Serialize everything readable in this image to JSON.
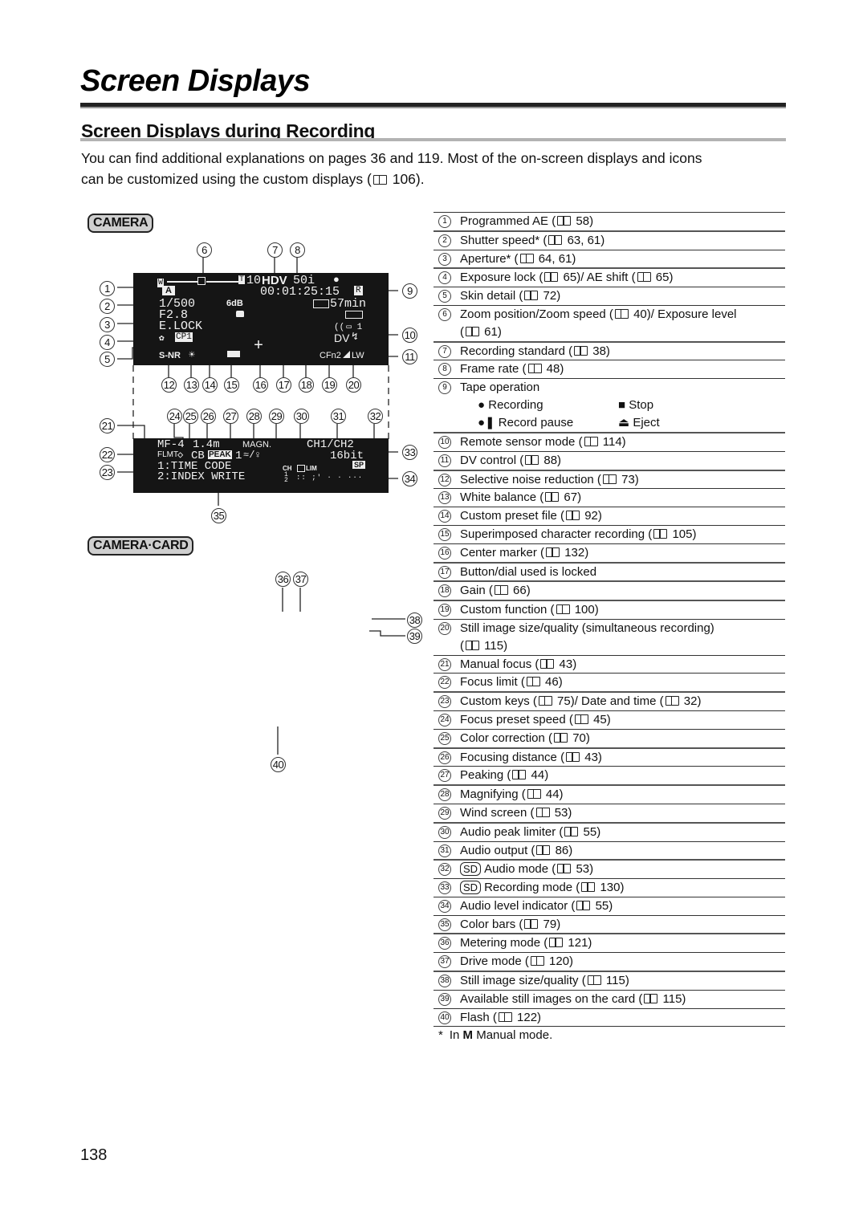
{
  "page": {
    "title": "Screen Displays",
    "section_title": "Screen Displays during Recording",
    "intro_line1": "You can find additional explanations on pages 36 and 119. Most of the on-screen displays and icons",
    "intro_line2_a": "can be customized using the custom displays (",
    "intro_line2_b": " 106).",
    "page_number": "138"
  },
  "diagrams": {
    "camera_badge": "CAMERA",
    "camera_card_badge": "CAMERA·CARD",
    "lcd_top": {
      "zoom_w": "W",
      "zoom_t": "T",
      "zoom_speed": "10",
      "recording_standard": "HDV",
      "frame_rate": "50i",
      "tape_op": "●",
      "program_ae": "A",
      "timecode": "00:01:25:15",
      "timecode_flag": "R",
      "shutter": "1/500",
      "gain": "6dB",
      "remaining": "57min",
      "aperture": "F2.8",
      "lock": "E.LOCK",
      "remote": "(( ▭ 1",
      "cp": "CP1",
      "dv": "DV",
      "snr": "S-NR",
      "wb": "☀",
      "center": "+",
      "cfn": "CFn2",
      "still": "LW"
    },
    "lcd_bottom": {
      "mf": "MF-4",
      "distance": "1.4m",
      "magn": "MAGN.",
      "channels": "CH1/CH2",
      "flmt": "FLMT",
      "cb": "CB",
      "peak": "PEAK",
      "peak_num": "1",
      "wind": "≈/♀",
      "bits": "16bit",
      "line1": "1:TIME CODE",
      "line2": "2:INDEX WRITE",
      "ch_label": "CH",
      "lim": "LIM",
      "sp": "SP",
      "ch_nums": "1\n2",
      "level": ":: ;' · · ···"
    },
    "callouts_top": [
      "1",
      "2",
      "3",
      "4",
      "5",
      "6",
      "7",
      "8",
      "9",
      "10",
      "11",
      "12",
      "13",
      "14",
      "15",
      "16",
      "17",
      "18",
      "19",
      "20"
    ],
    "callouts_bottom": [
      "21",
      "22",
      "23",
      "24",
      "25",
      "26",
      "27",
      "28",
      "29",
      "30",
      "31",
      "32",
      "33",
      "34",
      "35"
    ],
    "callouts_card": [
      "36",
      "37",
      "38",
      "39",
      "40"
    ]
  },
  "legend": [
    {
      "n": "1",
      "text": "Programmed AE (",
      "ref": " 58)"
    },
    {
      "n": "2",
      "text": "Shutter speed* (",
      "ref": " 63, 61)"
    },
    {
      "n": "3",
      "text": "Aperture* (",
      "ref": " 64, 61)"
    },
    {
      "n": "4",
      "text": "Exposure lock (",
      "ref": " 65)/ AE shift (",
      "ref2": " 65)"
    },
    {
      "n": "5",
      "text": "Skin detail (",
      "ref": " 72)"
    },
    {
      "n": "6",
      "text": "Zoom position/Zoom speed (",
      "ref": " 40)/ Exposure level",
      "cont": " 61)"
    },
    {
      "n": "7",
      "text": "Recording standard (",
      "ref": " 38)"
    },
    {
      "n": "8",
      "text": "Frame rate (",
      "ref": " 48)"
    },
    {
      "n": "9",
      "text": "Tape operation"
    },
    {
      "n": "10",
      "text": "Remote sensor mode (",
      "ref": " 114)"
    },
    {
      "n": "11",
      "text": "DV control (",
      "ref": " 88)"
    },
    {
      "n": "12",
      "text": "Selective noise reduction (",
      "ref": " 73)"
    },
    {
      "n": "13",
      "text": "White balance (",
      "ref": " 67)"
    },
    {
      "n": "14",
      "text": "Custom preset file (",
      "ref": " 92)"
    },
    {
      "n": "15",
      "text": "Superimposed character recording (",
      "ref": " 105)"
    },
    {
      "n": "16",
      "text": "Center marker (",
      "ref": " 132)"
    },
    {
      "n": "17",
      "text": "Button/dial used is locked"
    },
    {
      "n": "18",
      "text": "Gain (",
      "ref": " 66)"
    },
    {
      "n": "19",
      "text": "Custom function (",
      "ref": " 100)"
    },
    {
      "n": "20",
      "text": "Still image size/quality (simultaneous recording)",
      "cont": " 115)"
    },
    {
      "n": "21",
      "text": "Manual focus (",
      "ref": " 43)"
    },
    {
      "n": "22",
      "text": "Focus limit (",
      "ref": " 46)"
    },
    {
      "n": "23",
      "text": "Custom keys (",
      "ref": " 75)/ Date and time (",
      "ref2": " 32)"
    },
    {
      "n": "24",
      "text": "Focus preset speed (",
      "ref": " 45)"
    },
    {
      "n": "25",
      "text": "Color correction (",
      "ref": " 70)"
    },
    {
      "n": "26",
      "text": "Focusing distance (",
      "ref": " 43)"
    },
    {
      "n": "27",
      "text": "Peaking (",
      "ref": " 44)"
    },
    {
      "n": "28",
      "text": "Magnifying (",
      "ref": " 44)"
    },
    {
      "n": "29",
      "text": "Wind screen (",
      "ref": " 53)"
    },
    {
      "n": "30",
      "text": "Audio peak limiter (",
      "ref": " 55)"
    },
    {
      "n": "31",
      "text": "Audio output (",
      "ref": " 86)"
    },
    {
      "n": "32",
      "sd": "SD",
      "text": "Audio mode (",
      "ref": " 53)"
    },
    {
      "n": "33",
      "sd": "SD",
      "text": "Recording mode (",
      "ref": " 130)"
    },
    {
      "n": "34",
      "text": "Audio level indicator (",
      "ref": " 55)"
    },
    {
      "n": "35",
      "text": "Color bars (",
      "ref": " 79)"
    },
    {
      "n": "36",
      "text": "Metering mode (",
      "ref": " 121)"
    },
    {
      "n": "37",
      "text": "Drive mode (",
      "ref": " 120)"
    },
    {
      "n": "38",
      "text": "Still image size/quality (",
      "ref": " 115)"
    },
    {
      "n": "39",
      "text": "Available still images on the card (",
      "ref": " 115)"
    },
    {
      "n": "40",
      "text": "Flash (",
      "ref": " 122)"
    }
  ],
  "tape_operations": {
    "recording": "Recording",
    "stop": "Stop",
    "record_pause": "Record pause",
    "eject": "Eject"
  },
  "footnote": {
    "star": "*",
    "pre": "In ",
    "bold": "M",
    "post": " Manual mode."
  }
}
